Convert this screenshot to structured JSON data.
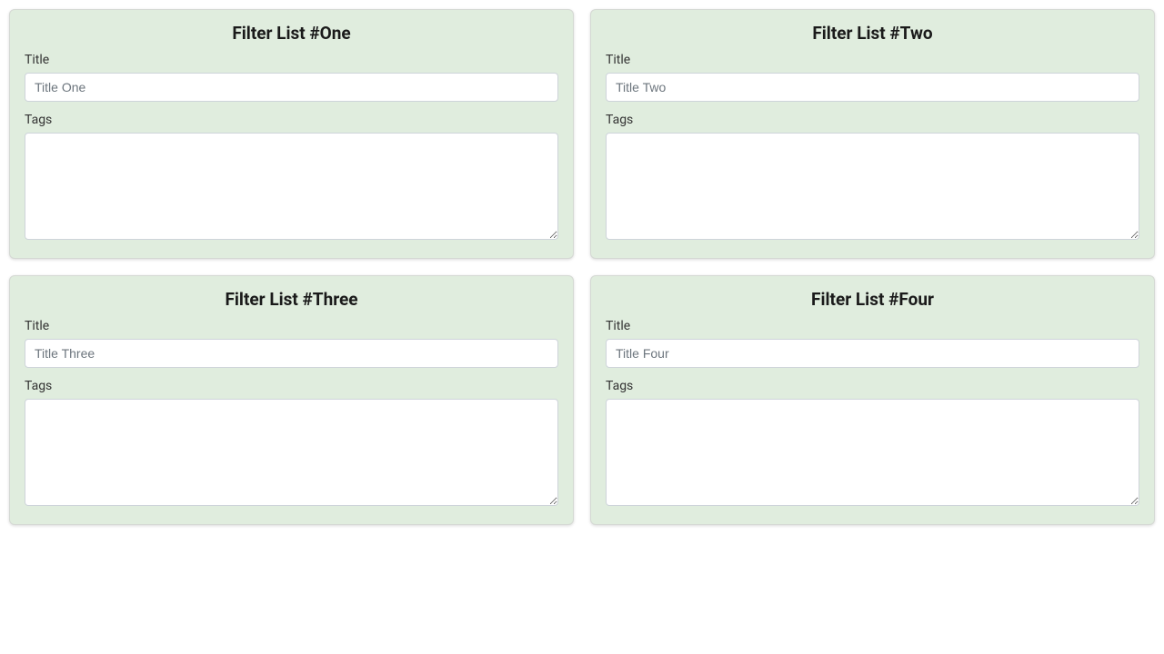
{
  "cards": [
    {
      "heading": "Filter List #One",
      "title_label": "Title",
      "title_placeholder": "Title One",
      "title_value": "",
      "tags_label": "Tags",
      "tags_value": ""
    },
    {
      "heading": "Filter List #Two",
      "title_label": "Title",
      "title_placeholder": "Title Two",
      "title_value": "",
      "tags_label": "Tags",
      "tags_value": ""
    },
    {
      "heading": "Filter List #Three",
      "title_label": "Title",
      "title_placeholder": "Title Three",
      "title_value": "",
      "tags_label": "Tags",
      "tags_value": ""
    },
    {
      "heading": "Filter List #Four",
      "title_label": "Title",
      "title_placeholder": "Title Four",
      "title_value": "",
      "tags_label": "Tags",
      "tags_value": ""
    }
  ]
}
